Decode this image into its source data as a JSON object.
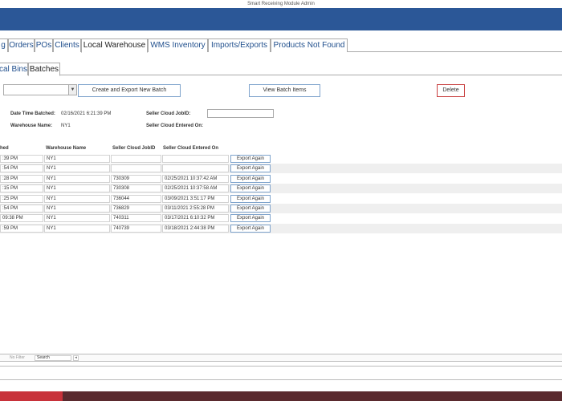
{
  "window": {
    "title": "Smart Receiving Module Admin"
  },
  "colors": {
    "banner": "#2b5797",
    "link_tab": "#1f4e8c",
    "delete_border": "#c94040",
    "bottom_band": "#5a2a2e",
    "bottom_accent": "#c8323a"
  },
  "main_tabs": [
    {
      "label": "g",
      "active": false
    },
    {
      "label": "Orders",
      "active": false
    },
    {
      "label": "POs",
      "active": false
    },
    {
      "label": "Clients",
      "active": false
    },
    {
      "label": "Local Warehouse",
      "active": true
    },
    {
      "label": "WMS Inventory",
      "active": false
    },
    {
      "label": "Imports/Exports",
      "active": false
    },
    {
      "label": "Products Not Found",
      "active": false
    }
  ],
  "sub_tabs": [
    {
      "label": "cal Bins",
      "active": false
    },
    {
      "label": "Batches",
      "active": true
    }
  ],
  "toolbar": {
    "batch_select_value": "",
    "create_label": "Create and Export New Batch",
    "view_label": "View Batch Items",
    "delete_label": "Delete"
  },
  "details": {
    "date_label": "Date Time Batched:",
    "date_value": "02/16/2021 6:21:39 PM",
    "warehouse_label": "Warehouse Name:",
    "warehouse_value": "NY1",
    "jobid_label": "Seller Cloud JobID:",
    "jobid_value": "",
    "entered_label": "Seller Cloud Entered On:",
    "entered_value": ""
  },
  "grid": {
    "headers": [
      "hed",
      "Warehouse Name",
      "Seller Cloud JobID",
      "Seller Cloud Entered On"
    ],
    "export_label": "Export Again",
    "rows": [
      {
        "time": ":39 PM",
        "warehouse": "NY1",
        "jobid": "",
        "entered": ""
      },
      {
        "time": ":54 PM",
        "warehouse": "NY1",
        "jobid": "",
        "entered": ""
      },
      {
        "time": ":28 PM",
        "warehouse": "NY1",
        "jobid": "730309",
        "entered": "02/25/2021 10:37:42 AM"
      },
      {
        "time": ":15 PM",
        "warehouse": "NY1",
        "jobid": "730308",
        "entered": "02/25/2021 10:37:58 AM"
      },
      {
        "time": ":25 PM",
        "warehouse": "NY1",
        "jobid": "736044",
        "entered": "03/09/2021 3:51:17 PM"
      },
      {
        "time": ":54 PM",
        "warehouse": "NY1",
        "jobid": "736829",
        "entered": "03/11/2021 2:55:28 PM"
      },
      {
        "time": "09:38 PM",
        "warehouse": "NY1",
        "jobid": "740311",
        "entered": "03/17/2021 6:10:32 PM"
      },
      {
        "time": ":59 PM",
        "warehouse": "NY1",
        "jobid": "740739",
        "entered": "03/18/2021 2:44:38 PM"
      }
    ]
  },
  "navigation": {
    "filter_label": "No Filter",
    "search_value": "Search"
  }
}
